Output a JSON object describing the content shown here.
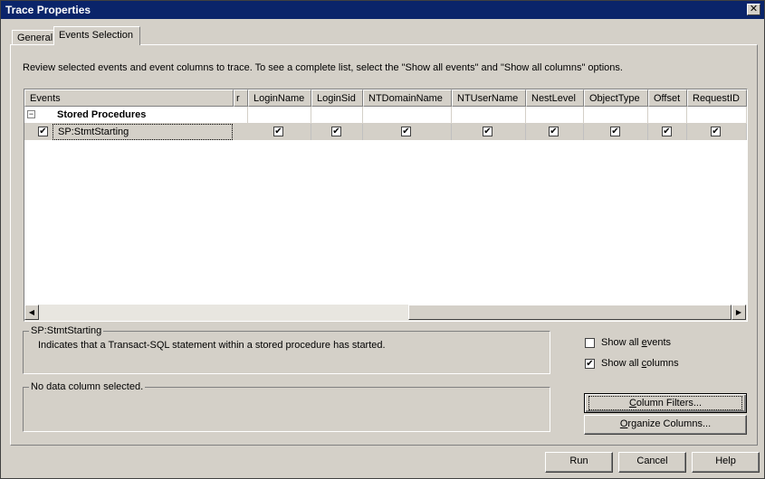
{
  "window": {
    "title": "Trace Properties",
    "close_symbol": "✕"
  },
  "tabs": [
    {
      "label": "General",
      "active": false
    },
    {
      "label": "Events Selection",
      "active": true
    }
  ],
  "instructions": "Review selected events and event columns to trace. To see a complete list, select the \"Show all events\" and \"Show all columns\" options.",
  "grid": {
    "columns": [
      "Events",
      "r",
      "LoginName",
      "LoginSid",
      "NTDomainName",
      "NTUserName",
      "NestLevel",
      "ObjectType",
      "Offset",
      "RequestID"
    ],
    "group": {
      "expander": "−",
      "label": "Stored Procedures"
    },
    "rows": [
      {
        "event": "SP:StmtStarting",
        "selected": true,
        "checks": [
          true,
          true,
          true,
          true,
          true,
          true,
          true,
          true
        ]
      }
    ]
  },
  "scrollbar": {
    "left_arrow": "◀",
    "right_arrow": "▶"
  },
  "event_description": {
    "title": "SP:StmtStarting",
    "text": "Indicates that a Transact-SQL statement within a stored procedure has started."
  },
  "column_description": {
    "title": "No data column selected."
  },
  "options": {
    "show_all_events": {
      "pre": "Show all ",
      "accel": "e",
      "post": "vents",
      "checked": false
    },
    "show_all_columns": {
      "pre": "Show all ",
      "accel": "c",
      "post": "olumns",
      "checked": true
    }
  },
  "buttons": {
    "column_filters": {
      "pre": "",
      "accel": "C",
      "post": "olumn Filters..."
    },
    "organize_columns": {
      "pre": "",
      "accel": "O",
      "post": "rganize Columns..."
    },
    "run": "Run",
    "cancel": "Cancel",
    "help": "Help"
  },
  "check_glyph": "✔",
  "colors": {
    "titlebar": "#0a246a",
    "dialog_bg": "#d4d0c8",
    "selected_row": "#d4d0c8"
  }
}
